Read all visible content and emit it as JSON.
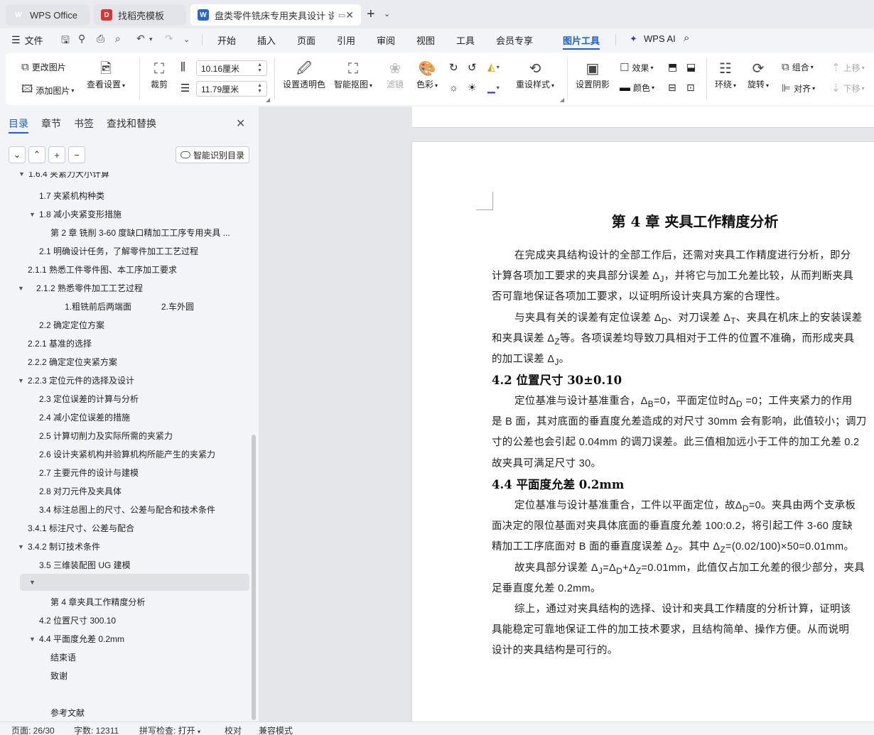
{
  "tabs": [
    {
      "label": "WPS Office",
      "icon": "wps-logo-icon"
    },
    {
      "label": "找稻壳模板",
      "icon": "template-icon"
    },
    {
      "label": "盘类零件铣床专用夹具设计 说",
      "icon": "word-doc-icon"
    }
  ],
  "menu": {
    "file": "文件",
    "items": [
      "开始",
      "插入",
      "页面",
      "引用",
      "审阅",
      "视图",
      "工具",
      "会员专享",
      "图片工具"
    ],
    "active": "图片工具",
    "wps_ai": "WPS AI"
  },
  "ribbon": {
    "change_image": "更改图片",
    "add_image": "添加图片",
    "view_settings": "查看设置",
    "crop": "裁剪",
    "width_value": "10.16厘米",
    "height_value": "11.79厘米",
    "set_transparent": "设置透明色",
    "smart_cutout": "智能抠图",
    "filter": "滤镜",
    "color": "色彩",
    "reset_style": "重设样式",
    "set_shadow": "设置阴影",
    "effect": "效果",
    "fill_color": "颜色",
    "wrap": "环绕",
    "rotate": "旋转",
    "group": "组合",
    "align": "对齐",
    "move_up": "上移",
    "move_down": "下移"
  },
  "panel": {
    "tabs": [
      "目录",
      "章节",
      "书签",
      "查找和替换"
    ],
    "smart_toc": "智能识别目录",
    "toc": [
      "1.6.4 夹紧力大小计算",
      "1.7  夹紧机构种类",
      "1.8  减小夹紧变形措施",
      "第 2 章   铣削 3-60 度缺口精加工工序专用夹具 ...",
      "2.1  明确设计任务，了解零件加工工艺过程",
      "2.1.1  熟悉工件零件图、本工序加工要求",
      "2.1.2  熟悉零件加工工艺过程",
      "1.粗铣前后两端面",
      "2.车外圆",
      "2.2  确定定位方案",
      "2.2.1  基准的选择",
      "2.2.2    确定定位夹紧方案",
      "2.2.3  定位元件的选择及设计",
      "2.3  定位误差的计算与分析",
      "2.4  减小定位误差的措施",
      "2.5  计算切削力及实际所需的夹紧力",
      "2.6  设计夹紧机构并验算机构所能产生的夹紧力",
      "2.7  主要元件的设计与建模",
      "2.8  对刀元件及夹具体",
      "3.4  标注总图上的尺寸、公差与配合和技术条件",
      "3.4.1  标注尺寸、公差与配合",
      "3.4.2 制订技术条件",
      "3.5  三维装配图 UG 建模",
      "第 4 章夹具工作精度分析",
      "4.2  位置尺寸 300.10",
      "4.4 平面度允差 0.2mm",
      "结束语",
      "致谢",
      "参考文献"
    ]
  },
  "document": {
    "title": "第 4 章  夹具工作精度分析",
    "lines": [
      "在完成夹具结构设计的全部工作后，还需对夹具工作精度进行分析，即分",
      "计算各项加工要求的夹具部分误差 Δ",
      "，并将它与加工允差比较，从而判断夹具",
      "否可靠地保证各项加工要求，以证明所设计夹具方案的合理性。",
      "与夹具有关的误差有定位误差 Δ",
      "、对刀误差 Δ",
      "、夹具在机床上的安装误差",
      "和夹具误差 Δ",
      "等。各项误差均导致刀具相对于工件的位置不准确，而形成夹具",
      "的加工误差 Δ",
      "。",
      "4.2  位置尺寸 30±0.10",
      "定位基准与设计基准重合，Δ",
      "=0，平面定位时Δ",
      " =0；工件夹紧力的作用",
      "是 B 面，其对底面的垂直度允差造成的对尺寸 30mm 会有影响，此值较小；调刀",
      "寸的公差也会引起 0.04mm 的调刀误差。此三值相加远小于工件的加工允差 0.2",
      "故夹具可满足尺寸 30。",
      "4.4  平面度允差 0.2mm",
      "定位基准与设计基准重合，工件以平面定位，故Δ",
      "=0。夹具由两个支承板",
      "面决定的限位基面对夹具体底面的垂直度允差 100:0.2，将引起工件 3-60 度缺",
      "精加工工序底面对 B 面的垂直度误差 Δ",
      "。其中 Δ",
      "=(0.02/100)×50=0.01mm。",
      "故夹具部分误差 Δ",
      "=Δ",
      "+Δ",
      "=0.01mm，此值仅占加工允差的很少部分，夹具",
      "足垂直度允差 0.2mm。",
      "综上，通过对夹具结构的选择、设计和夹具工作精度的分析计算，证明该",
      "具能稳定可靠地保证工件的加工技术要求，且结构简单、操作方便。从而说明",
      "设计的夹具结构是可行的。"
    ],
    "subs": {
      "J": "J",
      "D": "D",
      "T": "T",
      "Z": "Z",
      "B": "B"
    }
  },
  "status": {
    "page": "页面: 26/30",
    "words": "字数: 12311",
    "spell": "拼写检查: 打开",
    "proof": "校对",
    "compat": "兼容模式"
  },
  "colors": {
    "accent": "#1a5fd6",
    "wps_red": "#d9262b",
    "doc_blue": "#2a63d4"
  }
}
